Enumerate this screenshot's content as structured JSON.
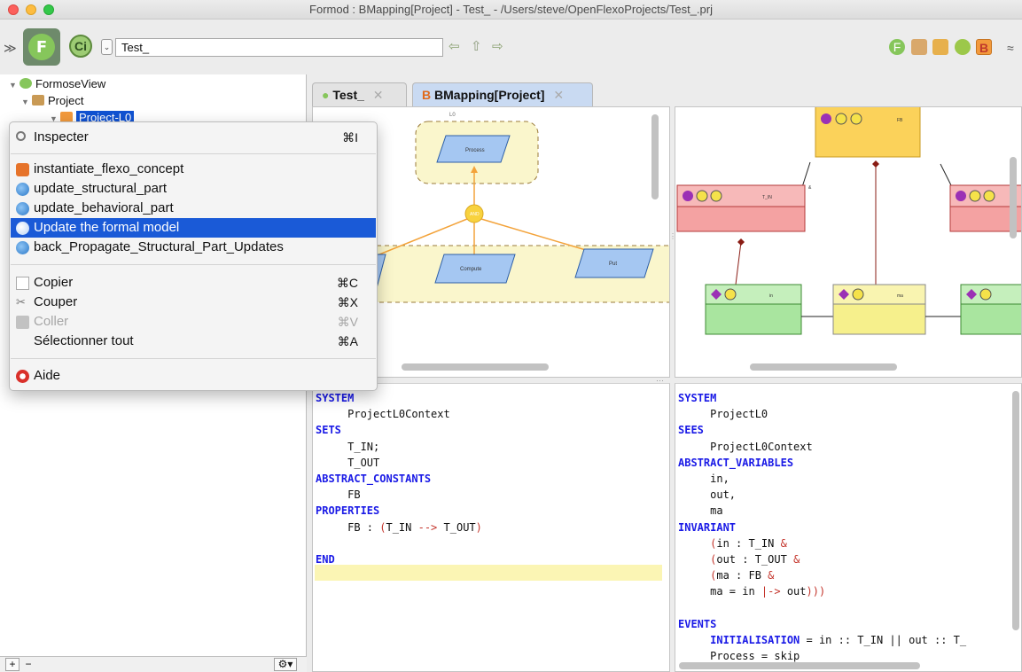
{
  "window": {
    "title": "Formod : BMapping[Project] - Test_ - /Users/steve/OpenFlexoProjects/Test_.prj"
  },
  "toolbar": {
    "project_field": "Test_",
    "nav": {
      "back": "⇦",
      "up": "⇧",
      "forward": "⇨"
    }
  },
  "tree": {
    "root": "FormoseView",
    "project": "Project",
    "selected": "Project-L0"
  },
  "tabs": [
    {
      "label": "Test_",
      "close": "✕"
    },
    {
      "label": "BMapping[Project]",
      "close": "✕"
    }
  ],
  "diagram_left": {
    "frame_title": "L0",
    "process": "Process",
    "and": "AND",
    "compute": "Compute",
    "put": "Put"
  },
  "diagram_right": {
    "fb": "FB",
    "t_in": "T_IN",
    "t_in_tag": "&",
    "in": "in",
    "ma": "ma"
  },
  "context_menu": {
    "items": [
      {
        "label": "Inspecter",
        "shortcut": "⌘I"
      },
      {
        "label": "instantiate_flexo_concept"
      },
      {
        "label": "update_structural_part"
      },
      {
        "label": "update_behavioral_part"
      },
      {
        "label": "Update the formal model"
      },
      {
        "label": "back_Propagate_Structural_Part_Updates"
      },
      {
        "label": "Copier",
        "shortcut": "⌘C"
      },
      {
        "label": "Couper",
        "shortcut": "⌘X"
      },
      {
        "label": "Coller",
        "shortcut": "⌘V"
      },
      {
        "label": "Sélectionner tout",
        "shortcut": "⌘A"
      },
      {
        "label": "Aide"
      }
    ]
  },
  "code_left": {
    "l1": "SYSTEM",
    "l2": "     ProjectL0Context",
    "l3": "SETS",
    "l4": "     T_IN;",
    "l5": "     T_OUT",
    "l6": "ABSTRACT_CONSTANTS",
    "l7": "     FB",
    "l8": "PROPERTIES",
    "l9a": "     FB : ",
    "l9b": "(",
    "l9c": "T_IN ",
    "l9d": "-->",
    "l9e": " T_OUT",
    "l9f": ")",
    "l10": "END"
  },
  "code_right": {
    "l1": "SYSTEM",
    "l2": "     ProjectL0",
    "l3": "SEES",
    "l4": "     ProjectL0Context",
    "l5": "ABSTRACT_VARIABLES",
    "l6": "     in,",
    "l7": "     out,",
    "l8": "     ma",
    "l9": "INVARIANT",
    "l10a": "     (",
    "l10b": "in : T_IN ",
    "l10c": "&",
    "l11a": "     (",
    "l11b": "out : T_OUT ",
    "l11c": "&",
    "l12a": "     (",
    "l12b": "ma : FB ",
    "l12c": "&",
    "l13a": "     ma = in ",
    "l13b": "|->",
    "l13c": " out",
    "l13d": ")))",
    "l14": "EVENTS",
    "l15a": "     INITIALISATION",
    "l15b": " = in :: T_IN || out :: T_",
    "l16": "     Process = skip"
  },
  "colors": {
    "selection": "#1a5ad7",
    "keyword": "#1a1ae6",
    "operator": "#c4342b",
    "highlight": "#fbf5b4"
  }
}
